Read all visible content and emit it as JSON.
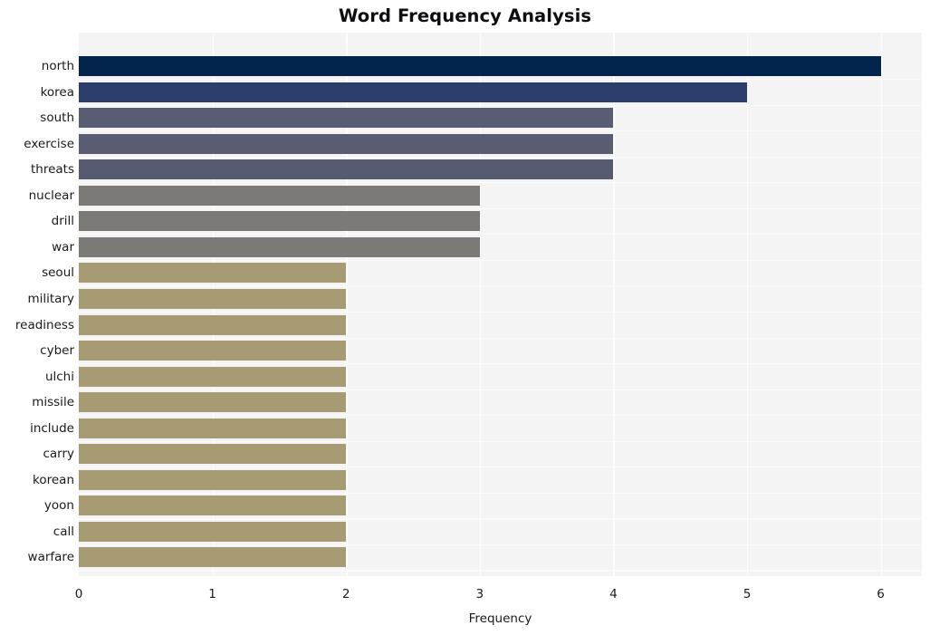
{
  "chart_data": {
    "type": "bar",
    "orientation": "horizontal",
    "title": "Word Frequency Analysis",
    "xlabel": "Frequency",
    "ylabel": "",
    "xlim": [
      0,
      6.3
    ],
    "xticks": [
      0,
      1,
      2,
      3,
      4,
      5,
      6
    ],
    "xticklabels": [
      "0",
      "1",
      "2",
      "3",
      "4",
      "5",
      "6"
    ],
    "grid": true,
    "legend": null,
    "categories": [
      "north",
      "korea",
      "south",
      "exercise",
      "threats",
      "nuclear",
      "drill",
      "war",
      "seoul",
      "military",
      "readiness",
      "cyber",
      "ulchi",
      "missile",
      "include",
      "carry",
      "korean",
      "yoon",
      "call",
      "warfare"
    ],
    "values": [
      6,
      5,
      4,
      4,
      4,
      3,
      3,
      3,
      2,
      2,
      2,
      2,
      2,
      2,
      2,
      2,
      2,
      2,
      2,
      2
    ],
    "bar_colors": [
      "#03244d",
      "#2c3e6b",
      "#585d73",
      "#585d73",
      "#565b71",
      "#7b7a77",
      "#7b7a77",
      "#7b7a77",
      "#a69b72",
      "#a69b72",
      "#a69b72",
      "#a69b72",
      "#a69b72",
      "#a69b72",
      "#a69b72",
      "#a69b72",
      "#a69b72",
      "#a69b72",
      "#a69b72",
      "#a69b72"
    ],
    "plot_background": "#f4f4f5",
    "gridline_color": "#fdfdfd",
    "figure_background": "#ffffff",
    "title_color": "#0d0d12",
    "tick_color": "#1a1a1a"
  }
}
